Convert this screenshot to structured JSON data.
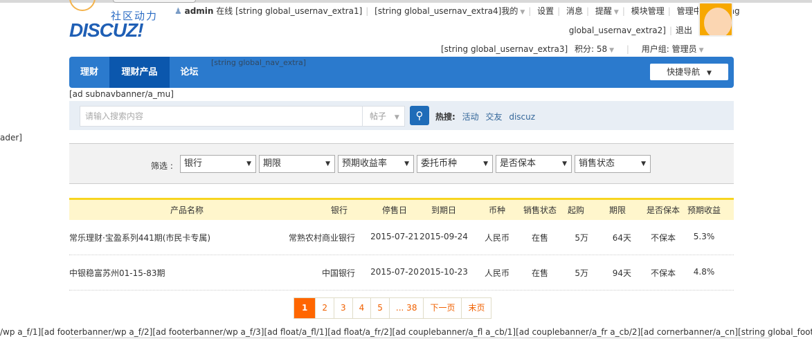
{
  "header": {
    "logo_cn": "社区动力",
    "logo_en": "DISCUZ!",
    "username": "admin",
    "online": "在线",
    "extra1": "[string global_usernav_extra1]",
    "extra4": "[string global_usernav_extra4]",
    "my": "我的",
    "settings": "设置",
    "messages": "消息",
    "remind": "提醒",
    "module_manage": "模块管理",
    "admin_center": "管理中心",
    "extra2a": "[string",
    "extra2b": "global_usernav_extra2]",
    "logout": "退出",
    "extra3": "[string global_usernav_extra3]",
    "points": "积分: 58",
    "usergroup": "用户组: 管理员"
  },
  "nav": {
    "items": [
      {
        "label": "理财"
      },
      {
        "label": "理财产品",
        "active": true
      },
      {
        "label": "论坛"
      }
    ],
    "extra": "[string global_nav_extra]",
    "quick": "快捷导航",
    "accent": "#2b7acd"
  },
  "subnav_ad": "[ad subnavbanner/a_mu]",
  "search": {
    "placeholder": "请输入搜索内容",
    "type": "帖子",
    "hot_label": "热搜:",
    "hot": [
      "活动",
      "交友",
      "discuz"
    ]
  },
  "left_cut": "ader]",
  "filter": {
    "label": "筛选 :",
    "selects": [
      "银行",
      "期限",
      "预期收益率",
      "委托币种",
      "是否保本",
      "销售状态"
    ]
  },
  "table": {
    "columns": [
      "产品名称",
      "银行",
      "停售日",
      "到期日",
      "币种",
      "销售状态",
      "起购",
      "期限",
      "是否保本",
      "预期收益"
    ],
    "rows": [
      [
        "常乐理财·宝盈系列441期(市民卡专属)",
        "常熟农村商业银行",
        "2015-07-21",
        "2015-09-24",
        "人民币",
        "在售",
        "5万",
        "64天",
        "不保本",
        "5.3%"
      ],
      [
        "中银稳富苏州01-15-83期",
        "中国银行",
        "2015-07-20",
        "2015-10-23",
        "人民币",
        "在售",
        "5万",
        "94天",
        "不保本",
        "4.8%"
      ]
    ]
  },
  "pager": {
    "pages": [
      "1",
      "2",
      "3",
      "4",
      "5",
      "... 38"
    ],
    "next": "下一页",
    "last": "末页",
    "current": "1"
  },
  "footer": "/wp a_f/1][ad footerbanner/wp a_f/2][ad footerbanner/wp a_f/3][ad float/a_fl/1][ad float/a_fr/2][ad couplebanner/a_fl a_cb/1][ad couplebanner/a_fr a_cb/2][ad cornerbanner/a_cn][string global_footer]"
}
